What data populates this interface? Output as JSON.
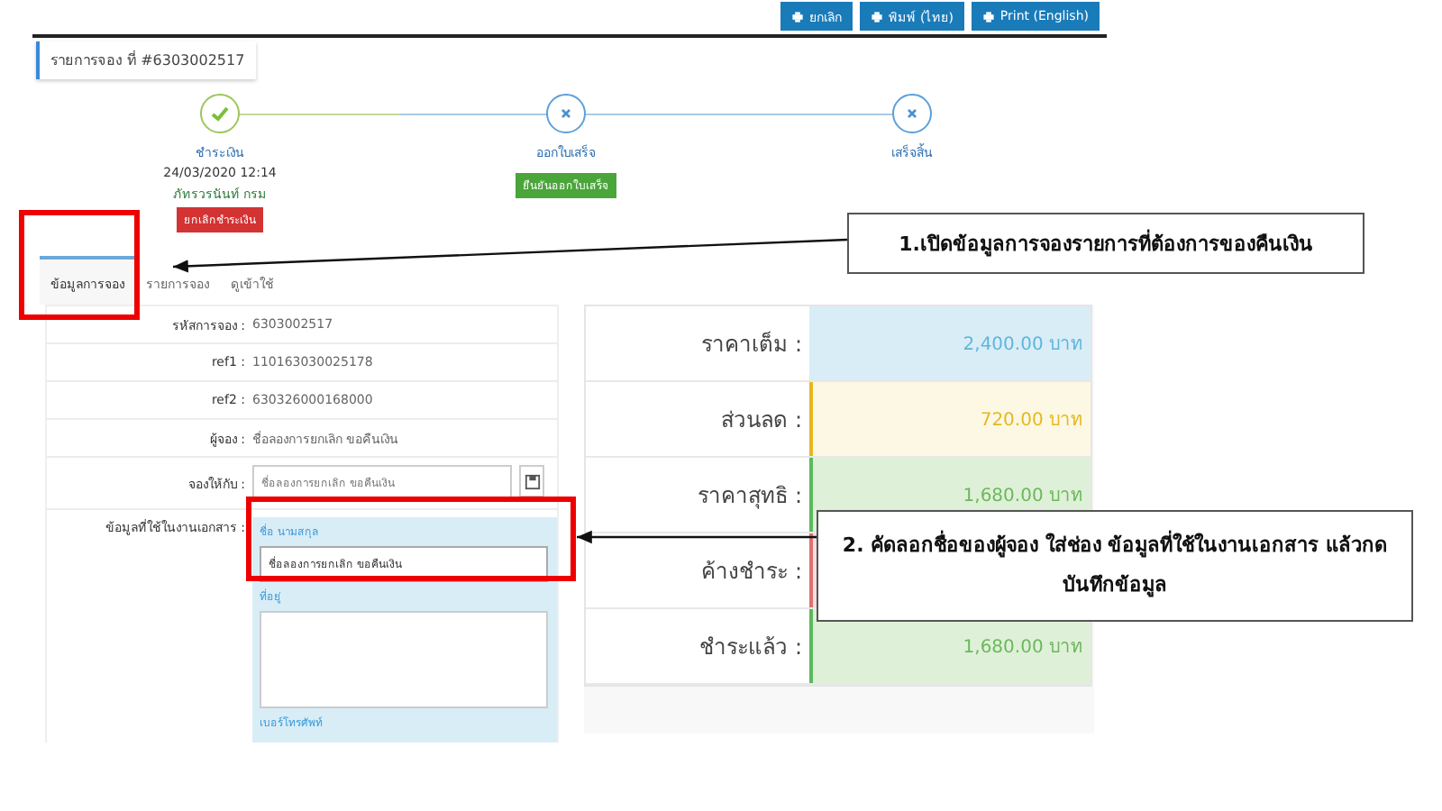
{
  "header": {
    "title": "รายการจอง ที่ #6303002517",
    "buttons": [
      {
        "label": "ยกเลิก"
      },
      {
        "label": "พิมพ์ (ไทย)"
      },
      {
        "label": "Print (English)"
      }
    ]
  },
  "steps": [
    {
      "label": "ชำระเงิน",
      "done": true,
      "time": "24/03/2020 12:14",
      "user": "ภัทรวรนันท์ กรม",
      "action": "ยกเลิกชำระเงิน",
      "color": "#d33333"
    },
    {
      "label": "ออกใบเสร็จ",
      "done": false,
      "action": "ยืนยันออกใบเสร็จ",
      "color": "#4aa53a"
    },
    {
      "label": "เสร็จสิ้น",
      "done": false
    }
  ],
  "tabs": [
    {
      "label": "ข้อมูลการจอง",
      "selected": true
    },
    {
      "label": "รายการจอง",
      "selected": false
    },
    {
      "label": "ดูเข้าใช้",
      "selected": false
    }
  ],
  "details": [
    {
      "label": "รหัสการจอง :",
      "value": "6303002517"
    },
    {
      "label": "ref1 :",
      "value": "110163030025178"
    },
    {
      "label": "ref2 :",
      "value": "630326000168000"
    },
    {
      "label": "ผู้จอง :",
      "value": "ชื่อลองการยกเลิก ขอคืนเงิน"
    }
  ],
  "book_for": {
    "label": "จองให้กับ :",
    "value": "ชื่อลองการยกเลิก ขอคืนเงิน"
  },
  "document": {
    "label": "ข้อมูลที่ใช้ในงานเอกสาร :",
    "name_label": "ชื่อ นามสกุล",
    "name_value": "ชื่อลองการยกเลิก ขอคืนเงิน",
    "address_label": "ที่อยู่",
    "phone_label": "เบอร์โทรศัพท์"
  },
  "prices": [
    {
      "label": "ราคาเต็ม :",
      "amount": "2,400.00",
      "unit": "บาท",
      "kind": "info"
    },
    {
      "label": "ส่วนลด :",
      "amount": "720.00",
      "unit": "บาท",
      "kind": "warning"
    },
    {
      "label": "ราคาสุทธิ :",
      "amount": "1,680.00",
      "unit": "บาท",
      "kind": "success"
    },
    {
      "label": "ค้างชำระ :",
      "kind": "danger"
    },
    {
      "label": "ชำระแล้ว :",
      "amount": "1,680.00",
      "unit": "บาท",
      "kind": "success"
    }
  ],
  "callouts": [
    {
      "text": "1.เปิดข้อมูลการจองรายการที่ต้องการของคืนเงิน"
    },
    {
      "text": "2. คัดลอกชื่อของผู้จอง ใส่ช่อง ข้อมูลที่ใช้ในงานเอกสาร แล้วกดบันทึกข้อมูล"
    }
  ]
}
